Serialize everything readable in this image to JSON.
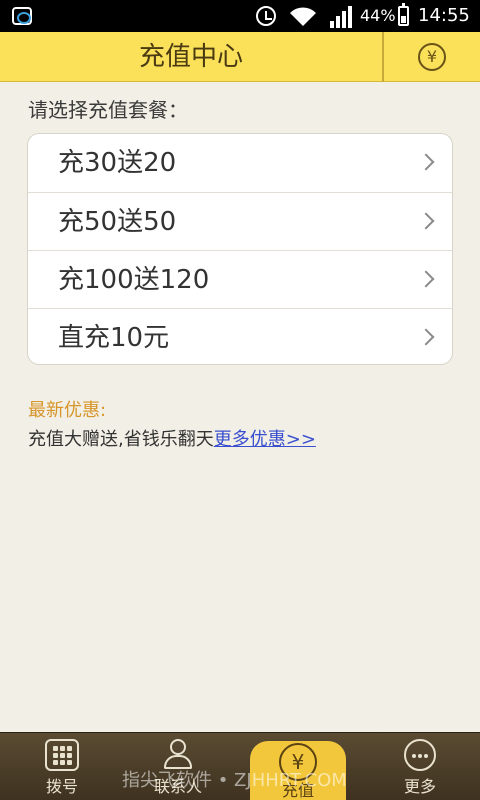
{
  "status_bar": {
    "battery_percent": "44%",
    "battery_level": 0.44,
    "time": "14:55"
  },
  "header": {
    "title": "充值中心",
    "yen_symbol": "¥"
  },
  "content": {
    "section_label": "请选择充值套餐：",
    "packages": [
      {
        "label": "充30送20",
        "active": false
      },
      {
        "label": "充50送50",
        "active": true
      },
      {
        "label": "充100送120",
        "active": false
      },
      {
        "label": "直充10元",
        "active": false
      }
    ],
    "promo_title": "最新优惠:",
    "promo_text": "充值大赠送,省钱乐翻天",
    "promo_link": "更多优惠>>"
  },
  "bottom_nav": {
    "items": [
      {
        "label": "拨号",
        "icon": "dialpad-icon"
      },
      {
        "label": "联系人",
        "icon": "contacts-icon"
      },
      {
        "label": "充值",
        "icon": "yen-icon",
        "active": true
      },
      {
        "label": "更多",
        "icon": "more-icon"
      }
    ]
  },
  "watermark": "指尖飞软件 • ZJHHRT.COM",
  "colors": {
    "header_bg": "#fbe05a",
    "page_bg": "#f1efe6",
    "active_package": "#e48b2e",
    "promo_title": "#d7952b",
    "link": "#3a4fcf",
    "nav_bg": "#4a3c27",
    "nav_active": "#f3c73b"
  }
}
